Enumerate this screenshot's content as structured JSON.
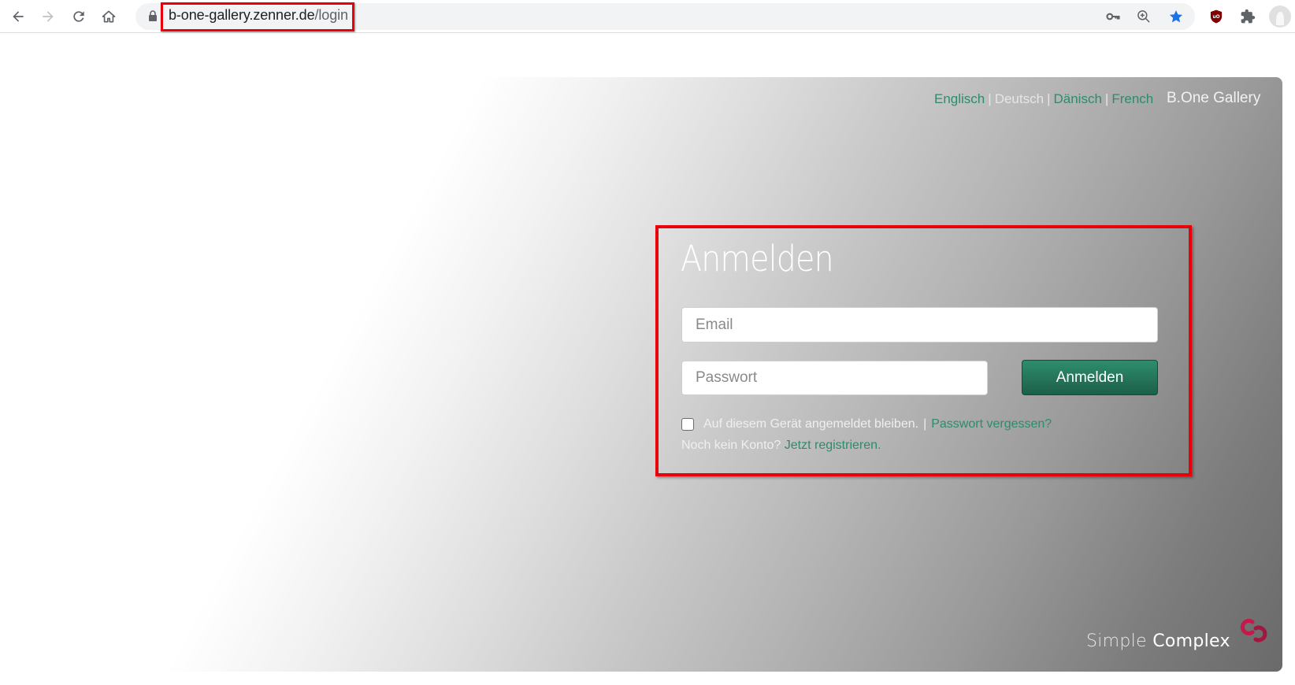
{
  "browser": {
    "url_host": "b-one-gallery.zenner.de",
    "url_path": "/login",
    "nav_icons": [
      "back-icon",
      "forward-icon",
      "reload-icon",
      "home-icon"
    ],
    "omnibox_icons": [
      "key-icon",
      "zoom-icon",
      "bookmark-star-icon"
    ],
    "extension_icons": [
      "ublock-origin-icon",
      "extensions-puzzle-icon",
      "profile-avatar-icon"
    ],
    "colors": {
      "star": "#1a73e8",
      "ublock": "#800000",
      "highlight": "#e8000b"
    }
  },
  "header": {
    "languages": [
      {
        "label": "Englisch",
        "active": false
      },
      {
        "label": "Deutsch",
        "active": true
      },
      {
        "label": "Dänisch",
        "active": false
      },
      {
        "label": "French",
        "active": false
      }
    ],
    "separator": "|",
    "brand": "B.One Gallery"
  },
  "login": {
    "title": "Anmelden",
    "email_placeholder": "Email",
    "email_value": "",
    "password_placeholder": "Passwort",
    "password_value": "",
    "submit_label": "Anmelden",
    "remember_label": "Auf diesem Gerät angemeldet bleiben.",
    "remember_checked": false,
    "pipe": "|",
    "forgot_label": "Passwort vergessen?",
    "no_account_label": "Noch kein Konto?",
    "register_label": "Jetzt registrieren."
  },
  "footer": {
    "logo_word1": "Simple",
    "logo_word2": "Complex",
    "accent_color": "#c8174b"
  }
}
